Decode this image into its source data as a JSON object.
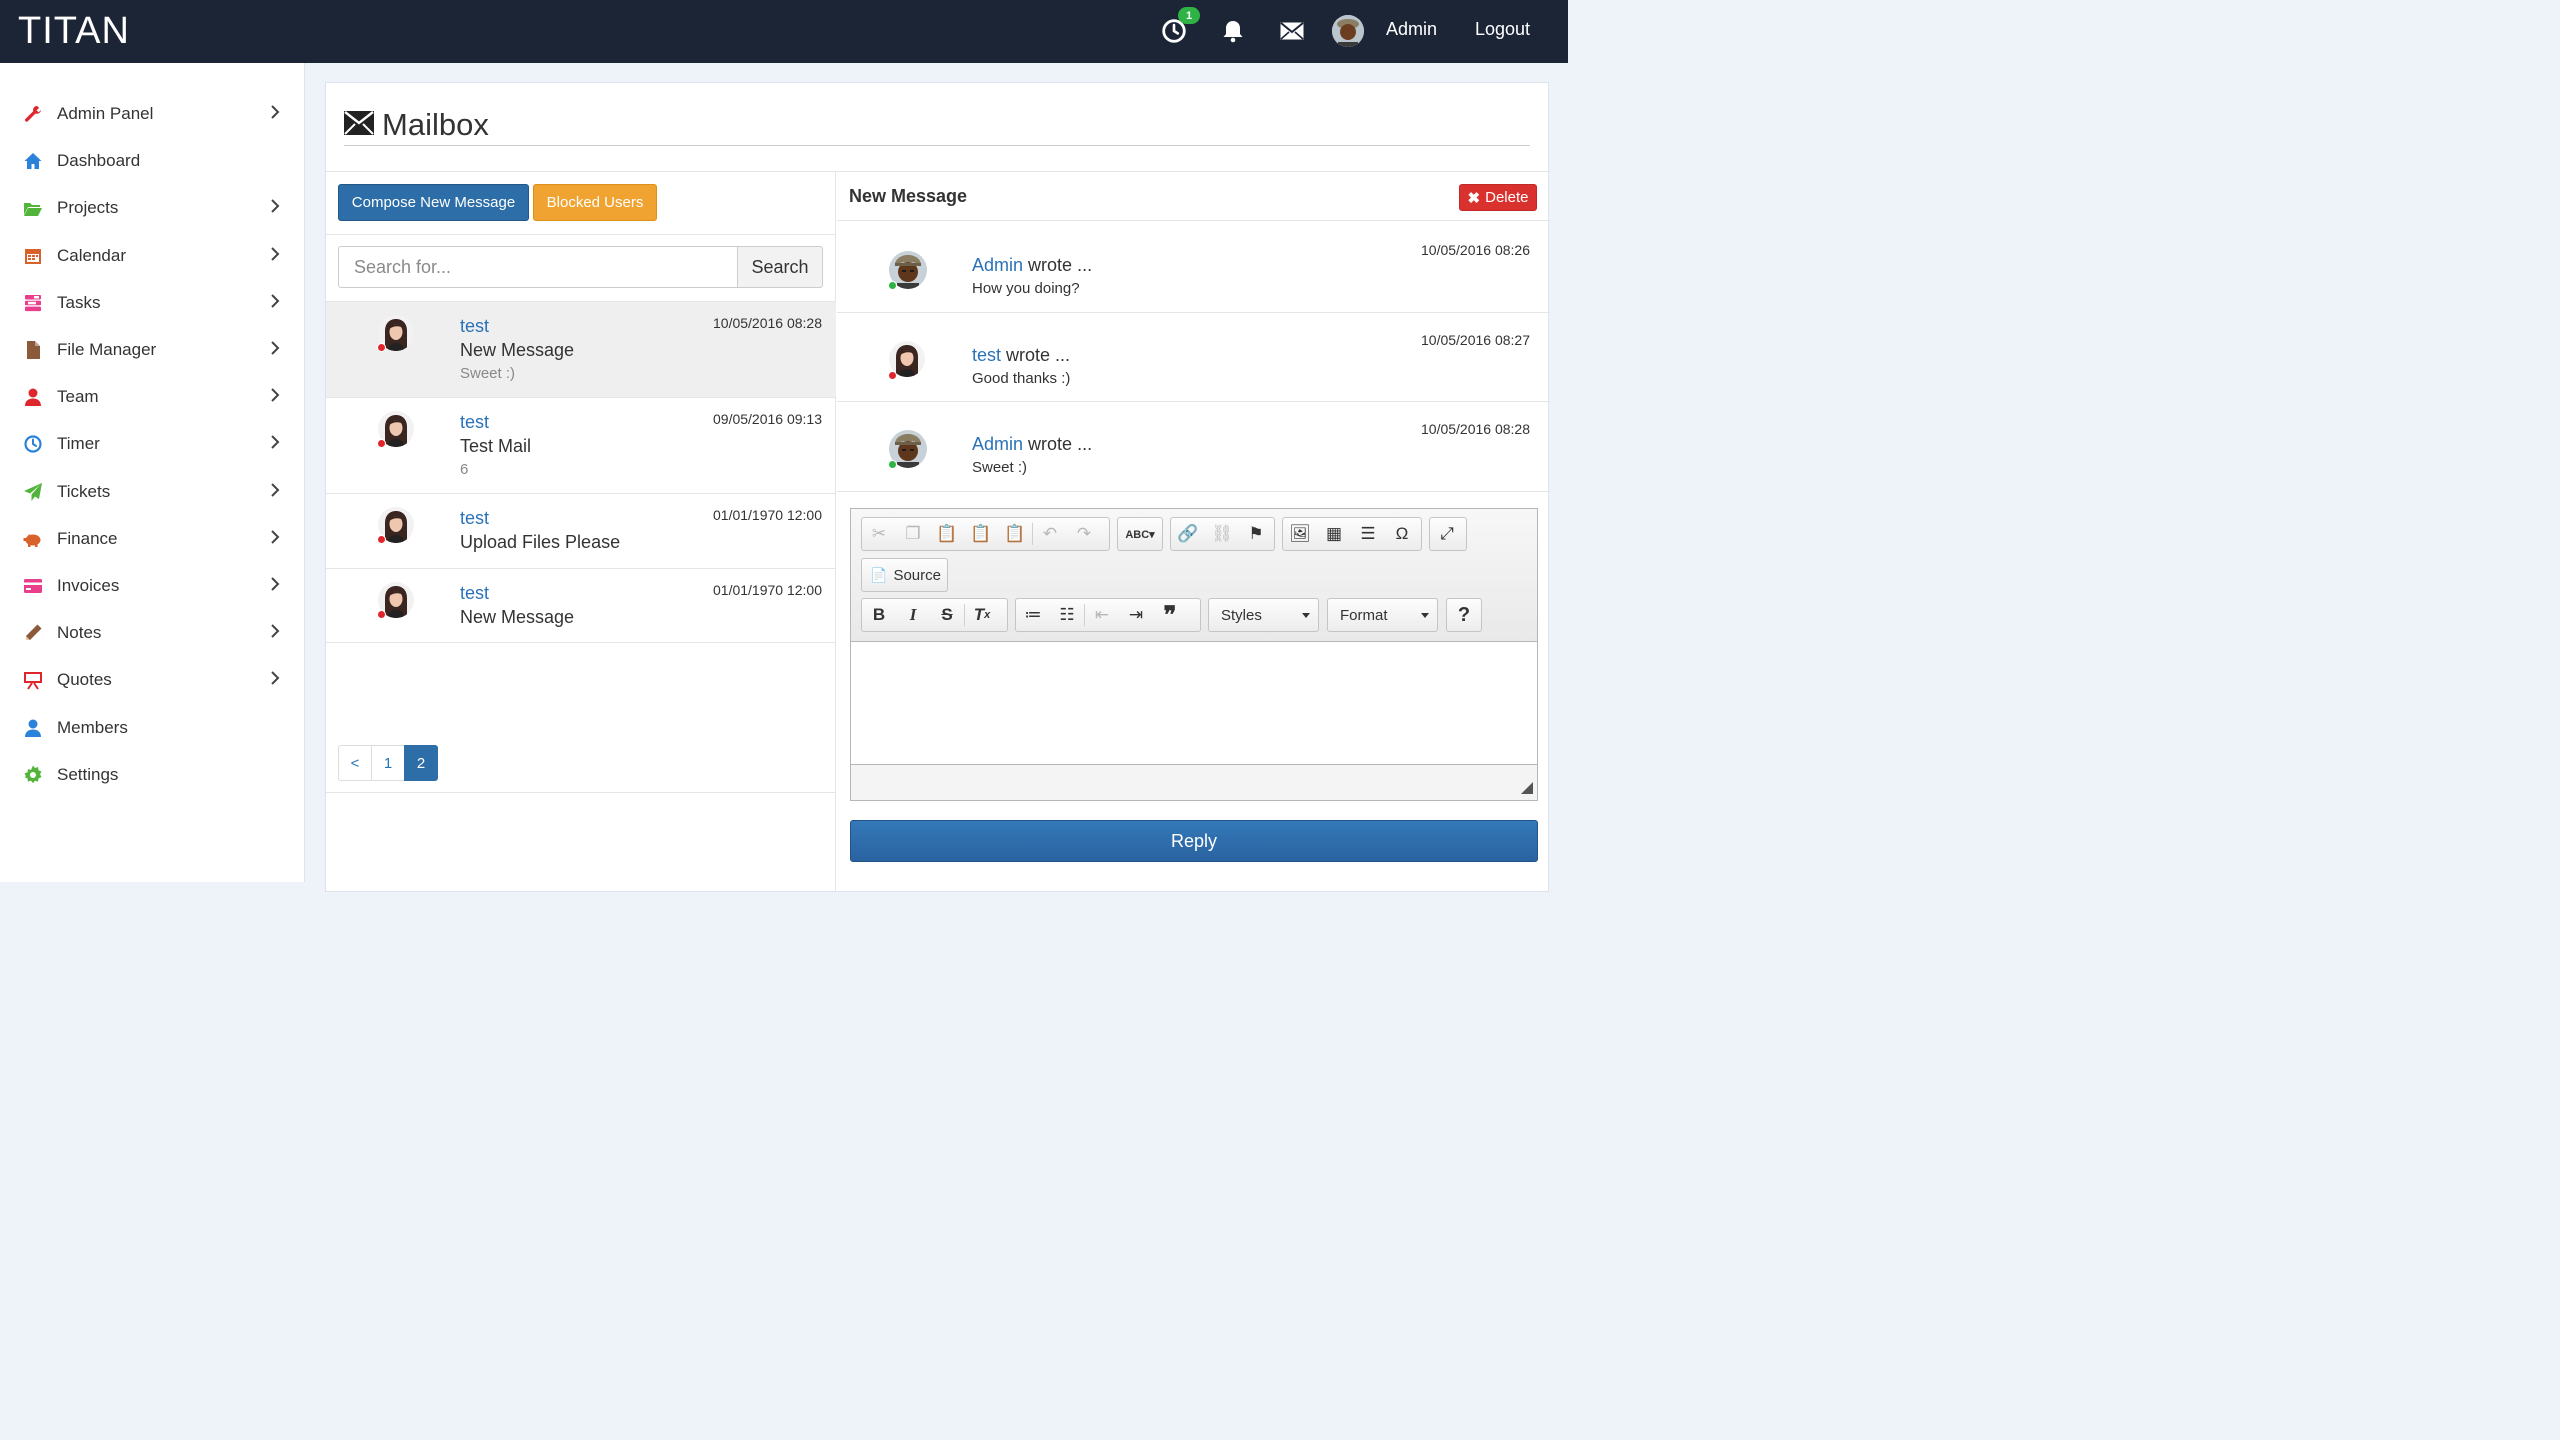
{
  "app": {
    "brand": "TITAN"
  },
  "topbar": {
    "timer_badge": "1",
    "user_label": "Admin",
    "logout_label": "Logout"
  },
  "sidebar": {
    "items": [
      {
        "label": "Admin Panel",
        "icon": "wrench-icon",
        "color": "#e0262d",
        "has_children": true
      },
      {
        "label": "Dashboard",
        "icon": "home-icon",
        "color": "#2a82d9",
        "has_children": false
      },
      {
        "label": "Projects",
        "icon": "folder-open-icon",
        "color": "#52b43a",
        "has_children": true
      },
      {
        "label": "Calendar",
        "icon": "calendar-icon",
        "color": "#d9622b",
        "has_children": true
      },
      {
        "label": "Tasks",
        "icon": "tasks-icon",
        "color": "#e83e8c",
        "has_children": true
      },
      {
        "label": "File Manager",
        "icon": "file-icon",
        "color": "#8a5a3b",
        "has_children": true
      },
      {
        "label": "Team",
        "icon": "user-icon",
        "color": "#e0262d",
        "has_children": true
      },
      {
        "label": "Timer",
        "icon": "clock-icon",
        "color": "#2a82d9",
        "has_children": true
      },
      {
        "label": "Tickets",
        "icon": "paper-plane-icon",
        "color": "#52b43a",
        "has_children": true
      },
      {
        "label": "Finance",
        "icon": "piggy-bank-icon",
        "color": "#d9622b",
        "has_children": true
      },
      {
        "label": "Invoices",
        "icon": "credit-card-icon",
        "color": "#e83e8c",
        "has_children": true
      },
      {
        "label": "Notes",
        "icon": "pencil-icon",
        "color": "#8a5a3b",
        "has_children": true
      },
      {
        "label": "Quotes",
        "icon": "presentation-icon",
        "color": "#e0262d",
        "has_children": true
      },
      {
        "label": "Members",
        "icon": "user-icon",
        "color": "#2a82d9",
        "has_children": false
      },
      {
        "label": "Settings",
        "icon": "gear-icon",
        "color": "#52b43a",
        "has_children": false
      }
    ]
  },
  "page": {
    "title": "Mailbox"
  },
  "mailbox": {
    "compose_label": "Compose New Message",
    "blocked_label": "Blocked Users",
    "search": {
      "placeholder": "Search for...",
      "value": "",
      "button_label": "Search"
    },
    "messages": [
      {
        "from": "test",
        "subject": "New Message",
        "preview": "Sweet :)",
        "date": "10/05/2016 08:28",
        "active": true
      },
      {
        "from": "test",
        "subject": "Test Mail",
        "preview": "6",
        "date": "09/05/2016 09:13",
        "active": false
      },
      {
        "from": "test",
        "subject": "Upload Files Please",
        "preview": "",
        "date": "01/01/1970 12:00",
        "active": false
      },
      {
        "from": "test",
        "subject": "New Message",
        "preview": "",
        "date": "01/01/1970 12:00",
        "active": false
      }
    ],
    "pagination": {
      "prev": "<",
      "pages": [
        "1",
        "2"
      ],
      "current": "2"
    }
  },
  "thread": {
    "title": "New Message",
    "delete_label": "Delete",
    "wrote_text": "wrote ...",
    "entries": [
      {
        "name": "Admin",
        "body": "How you doing?",
        "date": "10/05/2016 08:26",
        "status_color": "#2fb344"
      },
      {
        "name": "test",
        "body": "Good thanks :)",
        "date": "10/05/2016 08:27",
        "status_color": "#e0262d"
      },
      {
        "name": "Admin",
        "body": "Sweet :)",
        "date": "10/05/2016 08:28",
        "status_color": "#2fb344"
      }
    ]
  },
  "editor": {
    "source_label": "Source",
    "styles_label": "Styles",
    "format_label": "Format",
    "help_label": "?",
    "content": ""
  },
  "reply_label": "Reply",
  "colors": {
    "topbar": "#1c2536",
    "primary": "#2d6ea8",
    "warning": "#f0a330",
    "danger": "#d9322e",
    "link": "#2a72b8",
    "online": "#2fb344",
    "offline": "#e0262d"
  }
}
